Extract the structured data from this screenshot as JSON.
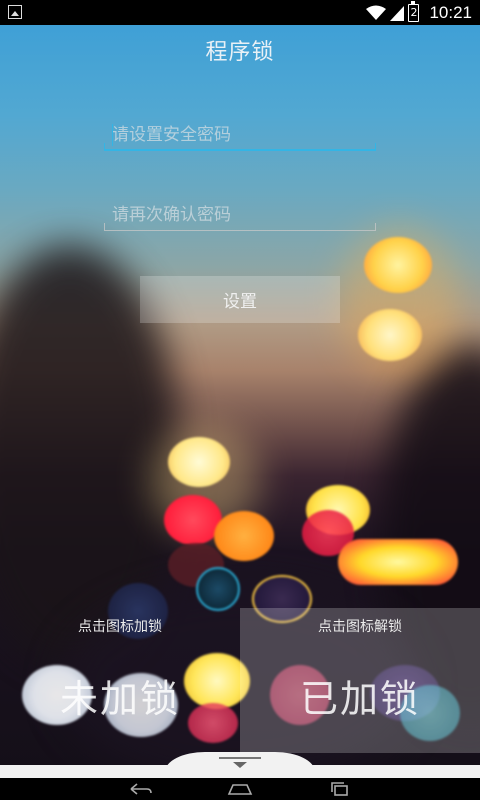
{
  "status_bar": {
    "left_icon": "image-notification-icon",
    "icons": [
      "wifi-icon",
      "signal-icon"
    ],
    "battery_level": "2",
    "time": "10:21"
  },
  "app": {
    "title": "程序锁"
  },
  "form": {
    "password_placeholder": "请设置安全密码",
    "password_value": "",
    "confirm_placeholder": "请再次确认密码",
    "confirm_value": "",
    "set_button_label": "设置"
  },
  "panels": {
    "unlocked": {
      "hint": "点击图标加锁",
      "label": "未加锁"
    },
    "locked": {
      "hint": "点击图标解锁",
      "label": "已加锁"
    }
  },
  "navigation": {
    "buttons": [
      "back-icon",
      "home-icon",
      "recent-apps-icon"
    ]
  },
  "colors": {
    "accent": "#33b5e5"
  }
}
